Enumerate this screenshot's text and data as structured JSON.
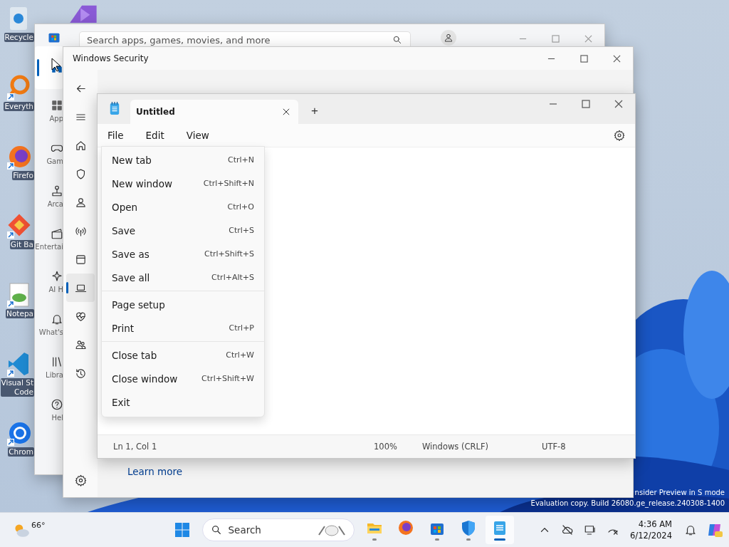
{
  "desktop_icons": [
    {
      "label": "Recycle"
    },
    {
      "label": "Everyth"
    },
    {
      "label": "Firefo"
    },
    {
      "label": "Git Ba"
    },
    {
      "label": "Notepa"
    },
    {
      "label": "Visual St\nCode"
    },
    {
      "label": "Chrom"
    }
  ],
  "store_window": {
    "search": {
      "placeholder": "Search apps, games, movies, and more"
    },
    "nav": [
      {
        "selected": true
      },
      {
        "label": "App",
        "selected": false
      },
      {
        "label": "Gam",
        "selected": false
      },
      {
        "label": "Arca",
        "selected": false
      },
      {
        "label": "Entertai",
        "selected": false
      },
      {
        "label": "AI H",
        "selected": false
      },
      {
        "label": "What's",
        "selected": false
      },
      {
        "label": "Libra",
        "selected": false
      },
      {
        "label": "Hel",
        "selected": false
      }
    ]
  },
  "security_window": {
    "title": "Windows Security",
    "nav": [
      {
        "selected": false
      },
      {
        "selected": false
      },
      {
        "selected": false
      },
      {
        "selected": false
      },
      {
        "selected": false
      },
      {
        "selected": false
      },
      {
        "selected": false
      },
      {
        "selected": true
      },
      {
        "selected": false
      },
      {
        "selected": false
      },
      {
        "selected": false
      }
    ],
    "link": "Learn more"
  },
  "notepad": {
    "tabs": [
      {
        "label": "Untitled",
        "selected": true
      }
    ],
    "new_tab": "+",
    "menu": [
      "File",
      "Edit",
      "View"
    ],
    "file_menu": [
      [
        {
          "label": "New tab",
          "shortcut": "Ctrl+N"
        },
        {
          "label": "New window",
          "shortcut": "Ctrl+Shift+N"
        },
        {
          "label": "Open",
          "shortcut": "Ctrl+O"
        },
        {
          "label": "Save",
          "shortcut": "Ctrl+S"
        },
        {
          "label": "Save as",
          "shortcut": "Ctrl+Shift+S"
        },
        {
          "label": "Save all",
          "shortcut": "Ctrl+Alt+S"
        }
      ],
      [
        {
          "label": "Page setup"
        },
        {
          "label": "Print",
          "shortcut": "Ctrl+P"
        }
      ],
      [
        {
          "label": "Close tab",
          "shortcut": "Ctrl+W"
        },
        {
          "label": "Close window",
          "shortcut": "Ctrl+Shift+W"
        },
        {
          "label": "Exit"
        }
      ]
    ],
    "status_bar": [
      "Ln 1, Col 1",
      "100%",
      "Windows (CRLF)",
      "UTF-8"
    ]
  },
  "watermark": [
    "nsider Preview in S mode",
    "Evaluation copy. Build 26080.ge_release.240308-1400"
  ],
  "taskbar": {
    "weather": "66°",
    "search": {
      "placeholder": "Search"
    },
    "apps": [
      {
        "running": true,
        "active": false
      },
      {
        "running": false,
        "active": false
      },
      {
        "running": true,
        "active": false
      },
      {
        "running": true,
        "active": false
      },
      {
        "running": true,
        "active": true
      }
    ],
    "time": "4:36 AM",
    "date": "6/12/2024"
  }
}
